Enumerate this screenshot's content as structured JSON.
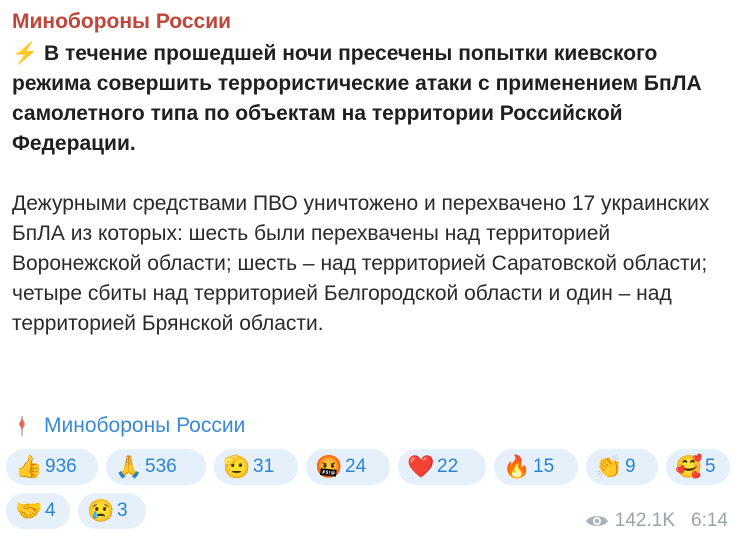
{
  "post": {
    "channel_name": "Минобороны России",
    "lightning_glyph": "⚡",
    "headline": "В течение прошедшей ночи пресечены попытки киевского режима совершить террористические атаки с применением БпЛА самолетного типа по объектам на территории Российской Федерации.",
    "body": "Дежурными средствами ПВО уничтожено и перехвачено 17 украинских БпЛА из которых: шесть были перехвачены над территорией Воронежской области; шесть – над территорией Саратовской области; четыре сбиты над территорией Белгородской области и один – над территорией Брянской области.",
    "signature": "Минобороны России",
    "reactions": [
      {
        "emoji": "👍",
        "count": "936",
        "icon": "thumbs-up-icon"
      },
      {
        "emoji": "🙏",
        "count": "536",
        "icon": "folded-hands-icon"
      },
      {
        "emoji": "🫡",
        "count": "31",
        "icon": "saluting-face-icon"
      },
      {
        "emoji": "🤬",
        "count": "24",
        "icon": "cursing-face-icon"
      },
      {
        "emoji": "❤️",
        "count": "22",
        "icon": "red-heart-icon"
      },
      {
        "emoji": "🔥",
        "count": "15",
        "icon": "fire-icon"
      },
      {
        "emoji": "👏",
        "count": "9",
        "icon": "clapping-hands-icon"
      },
      {
        "emoji": "🥰",
        "count": "5",
        "icon": "smiling-face-hearts-icon"
      },
      {
        "emoji": "🤝",
        "count": "4",
        "icon": "handshake-icon"
      },
      {
        "emoji": "😢",
        "count": "3",
        "icon": "crying-face-icon"
      }
    ],
    "views": "142.1K",
    "time": "6:14"
  },
  "colors": {
    "channel_name": "#c0453a",
    "link": "#3a8ad8",
    "reaction_bg": "#e5f0fb",
    "reaction_count": "#2a84d3",
    "meta": "#9aa4ad"
  }
}
